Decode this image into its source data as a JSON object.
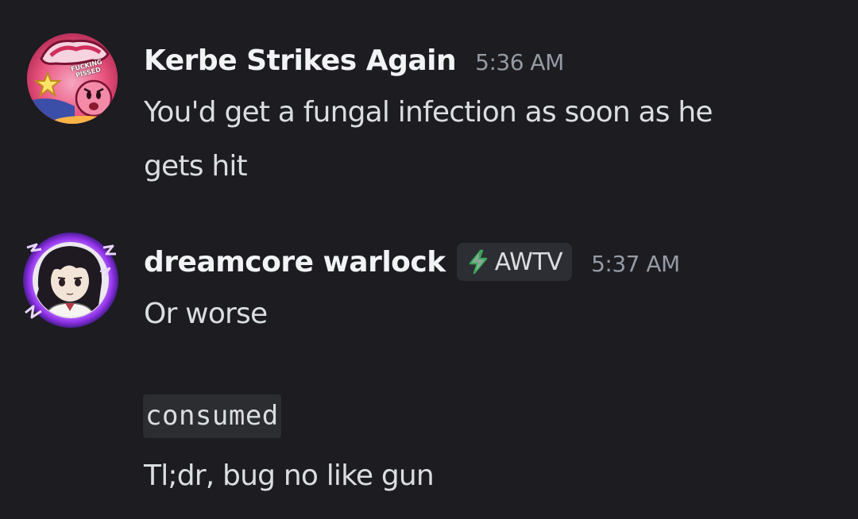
{
  "messages": [
    {
      "username": "Kerbe Strikes Again",
      "timestamp": "5:36 AM",
      "avatar_icon": "kirby-angry-avatar-icon",
      "avatar_text": "FUCKING PISSED",
      "lines": [
        "You'd get a fungal infection as soon as he",
        "gets hit"
      ]
    },
    {
      "username": "dreamcore warlock",
      "tag": {
        "icon": "lightning-bolt-icon",
        "label": "AWTV"
      },
      "timestamp": "5:37 AM",
      "avatar_icon": "anime-girl-purple-avatar-icon",
      "lines": [
        "Or worse"
      ],
      "code": "consumed",
      "final_line": "Tl;dr, bug no like gun"
    }
  ],
  "colors": {
    "background": "#1c1c21",
    "username": "#f2f3f5",
    "text": "#dbdee1",
    "timestamp": "#949ba4",
    "tag_bg": "#2c2e33",
    "code_bg": "#2b2d31",
    "bolt": "#3ba55c",
    "avatar_glow": "#a855f7"
  }
}
